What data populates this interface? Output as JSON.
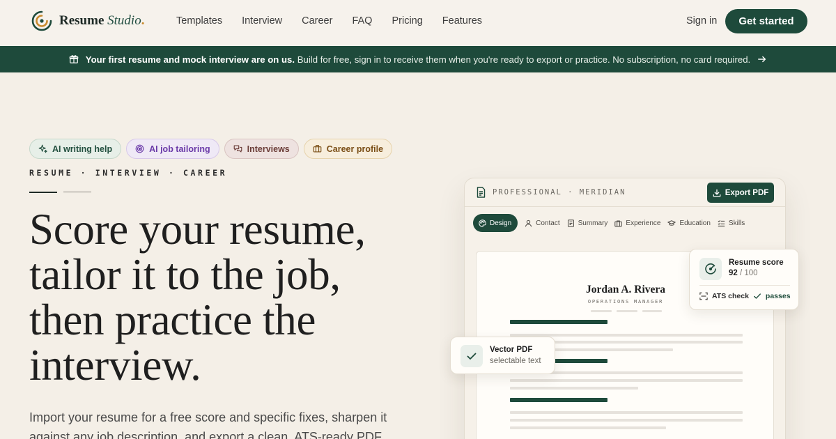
{
  "brand": {
    "name": "Resume",
    "name_italic": "Studio",
    "name_dot": "."
  },
  "nav": {
    "links": [
      "Templates",
      "Interview",
      "Career",
      "FAQ",
      "Pricing",
      "Features"
    ],
    "sign_in": "Sign in",
    "cta": "Get started"
  },
  "banner": {
    "bold": "Your first resume and mock interview are on us.",
    "text": "Build for free, sign in to receive them when you're ready to export or practice. No subscription, no card required."
  },
  "hero": {
    "chips": [
      "AI writing help",
      "AI job tailoring",
      "Interviews",
      "Career profile"
    ],
    "kicker": "RESUME · INTERVIEW · CAREER",
    "headline": "Score your resume, tailor it to the job, then practice the interview.",
    "lead": "Import your resume for a free score and specific fixes, sharpen it against any job description, and export a clean, ATS-ready PDF."
  },
  "editor": {
    "title": "PROFESSIONAL · MERIDIAN",
    "export_label": "Export PDF",
    "tabs": [
      "Design",
      "Contact",
      "Summary",
      "Experience",
      "Education",
      "Skills"
    ],
    "candidate_name": "Jordan A. Rivera",
    "candidate_role": "OPERATIONS MANAGER"
  },
  "score_card": {
    "label": "Resume score",
    "score": "92",
    "out_of": "/ 100",
    "ats_label": "ATS check",
    "ats_status": "passes"
  },
  "pdf_card": {
    "title": "Vector PDF",
    "subtitle": "selectable text"
  },
  "colors": {
    "brand_green": "#1e4a3b",
    "accent_gold": "#c88a2e",
    "background": "#f4efe7"
  }
}
